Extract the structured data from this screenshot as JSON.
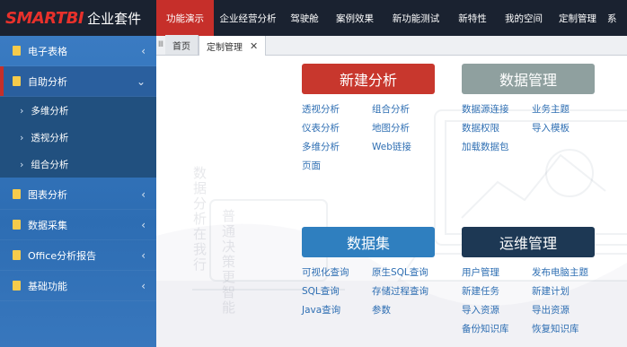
{
  "brand": {
    "logo": "SMARTBI",
    "suite": "企业套件"
  },
  "topnav": [
    {
      "label": "功能演示",
      "active": true
    },
    {
      "label": "企业经营分析",
      "active": false
    },
    {
      "label": "驾驶舱",
      "active": false
    },
    {
      "label": "案例效果",
      "active": false
    },
    {
      "label": "新功能测试",
      "active": false
    },
    {
      "label": "新特性",
      "active": false
    },
    {
      "label": "我的空间",
      "active": false
    },
    {
      "label": "定制管理",
      "active": false
    },
    {
      "label": "系",
      "active": false
    }
  ],
  "sidebar": {
    "items": [
      {
        "label": "电子表格",
        "arrow": "‹"
      },
      {
        "label": "自助分析",
        "arrow": "⌄"
      },
      {
        "label": "图表分析",
        "arrow": "‹"
      },
      {
        "label": "数据采集",
        "arrow": "‹"
      },
      {
        "label": "Office分析报告",
        "arrow": "‹"
      },
      {
        "label": "基础功能",
        "arrow": "‹"
      }
    ],
    "subitems": [
      {
        "label": "多维分析"
      },
      {
        "label": "透视分析"
      },
      {
        "label": "组合分析"
      }
    ]
  },
  "tabs": {
    "home": "首页",
    "active": "定制管理",
    "close": "✕",
    "grip": "Ⅲ"
  },
  "watermark": [
    "数据分析在我行",
    "普通决策更智能"
  ],
  "modules": [
    {
      "title": "新建分析",
      "color": "#c8372d",
      "links": [
        "透视分析",
        "组合分析",
        "仪表分析",
        "地图分析",
        "多维分析",
        "Web链接",
        "页面",
        ""
      ]
    },
    {
      "title": "数据管理",
      "color": "#8fa09f",
      "links": [
        "数据源连接",
        "业务主题",
        "数据权限",
        "导入模板",
        "加载数据包",
        ""
      ]
    },
    {
      "title": "数据集",
      "color": "#2f7fbf",
      "links": [
        "可视化查询",
        "原生SQL查询",
        "SQL查询",
        "存储过程查询",
        "Java查询",
        "参数"
      ]
    },
    {
      "title": "运维管理",
      "color": "#1d3854",
      "links": [
        "用户管理",
        "发布电脑主题",
        "新建任务",
        "新建计划",
        "导入资源",
        "导出资源",
        "备份知识库",
        "恢复知识库"
      ]
    }
  ]
}
